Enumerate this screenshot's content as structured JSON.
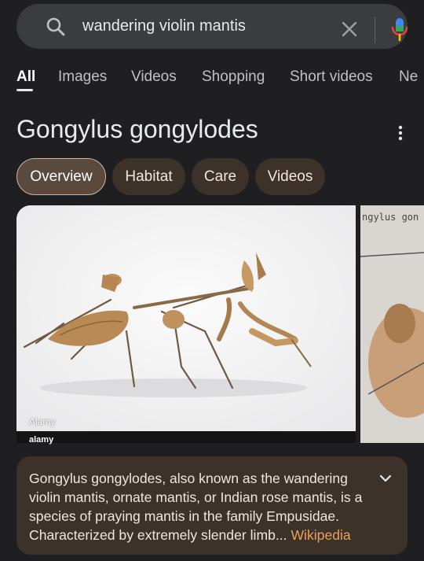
{
  "search": {
    "query": "wandering violin mantis"
  },
  "tabs": [
    {
      "label": "All",
      "active": true
    },
    {
      "label": "Images"
    },
    {
      "label": "Videos"
    },
    {
      "label": "Shopping"
    },
    {
      "label": "Short videos"
    },
    {
      "label": "Ne"
    }
  ],
  "knowledge_panel": {
    "title": "Gongylus gongylodes",
    "chips": [
      "Overview",
      "Habitat",
      "Care",
      "Videos"
    ],
    "images": {
      "main_credit": "Alamy",
      "main_brand": "alamy",
      "side_caption": "ngylus gon"
    },
    "description": {
      "text": "Gongylus gongylodes, also known as the wandering violin mantis, ornate mantis, or Indian rose mantis, is a species of praying mantis in the family Empusidae. Characterized by extremely slender limb...",
      "source": "Wikipedia"
    }
  },
  "colors": {
    "background": "#1f1f22",
    "chip": "#3d322a",
    "link": "#e8a15b"
  }
}
